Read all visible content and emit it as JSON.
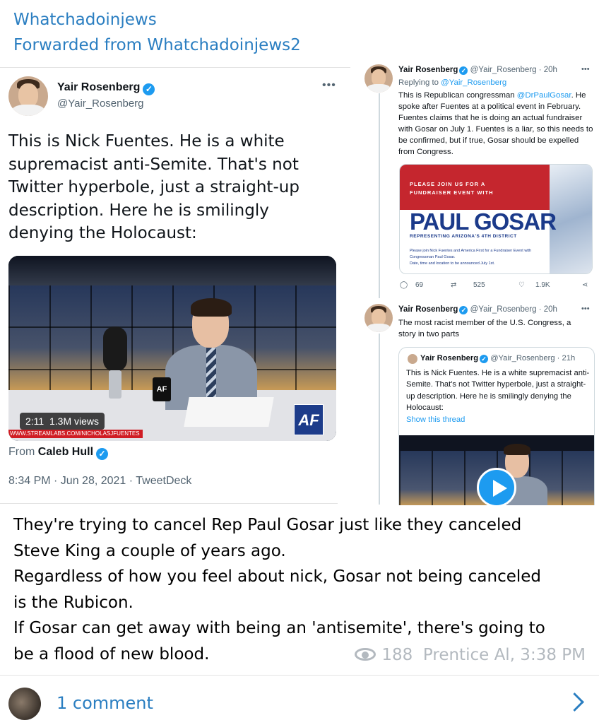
{
  "channel": {
    "title": "Whatchadoinjews",
    "forwarded_from": "Forwarded from Whatchadoinjews2"
  },
  "main_tweet": {
    "author_name": "Yair Rosenberg",
    "author_handle": "@Yair_Rosenberg",
    "verified_glyph": "✓",
    "more_label": "•••",
    "text": "This is Nick Fuentes. He is a white supremacist anti-Semite. That's not Twitter hyperbole, just a straight-up description. Here he is smilingly denying the Holocaust:",
    "video": {
      "duration": "2:11",
      "views": "1.3M views",
      "ticker": "WWW.STREAMLABS.COM/NICHOLASJFUENTES",
      "logo": "AF",
      "mug_logo": "AF"
    },
    "from_prefix": "From",
    "from_name": "Caleb Hull",
    "meta": "8:34 PM · Jun 28, 2021 · TweetDeck"
  },
  "thread": {
    "tweet1": {
      "author_name": "Yair Rosenberg",
      "handle_time": "@Yair_Rosenberg · 20h",
      "replying_prefix": "Replying to",
      "replying_to": "@Yair_Rosenberg",
      "text_before": "This is Republican congressman",
      "mention": "@DrPaulGosar",
      "text_after": ". He spoke after Fuentes at a political event in February. Fuentes claims that he is doing an actual fundraiser with Gosar on July 1. Fuentes is a liar, so this needs to be confirmed, but if true, Gosar should be expelled from Congress.",
      "card": {
        "heading": "PLEASE JOIN US FOR A FUNDRAISER EVENT WITH",
        "title": "PAUL GOSAR",
        "subtitle": "REPRESENTING ARIZONA'S 4TH DISTRICT",
        "fine_print_1": "Please join Nick Fuentes and America First for a Fundraiser Event with Congressman Paul Gosar.",
        "fine_print_2": "Date, time and location to be announced July 1st."
      },
      "actions": {
        "replies": "69",
        "retweets": "525",
        "likes": "1.9K"
      }
    },
    "tweet2": {
      "author_name": "Yair Rosenberg",
      "handle_time": "@Yair_Rosenberg · 20h",
      "text": "The most racist member of the U.S. Congress, a story in two parts",
      "quoted": {
        "author_name": "Yair Rosenberg",
        "handle_time": "@Yair_Rosenberg · 21h",
        "text": "This is Nick Fuentes. He is a white supremacist anti-Semite. That's not Twitter hyperbole, just a straight-up description. Here he is smilingly denying the Holocaust:",
        "show_thread": "Show this thread"
      }
    }
  },
  "caption": {
    "lines": [
      "They're trying to cancel Rep Paul Gosar just like they canceled",
      "Steve King a couple of years ago.",
      "Regardless of how you feel about nick, Gosar not being canceled",
      "is the Rubicon.",
      "If Gosar can get away with being an 'antisemite', there's going to",
      "be a flood of new blood."
    ]
  },
  "post_meta": {
    "views": "188",
    "author_time": "Prentice Al, 3:38 PM"
  },
  "comments": {
    "label": "1 comment"
  },
  "colors": {
    "channel_blue": "#2a7ec1",
    "twitter_blue": "#1d9bf0",
    "meta_gray": "#b3b9bf"
  }
}
